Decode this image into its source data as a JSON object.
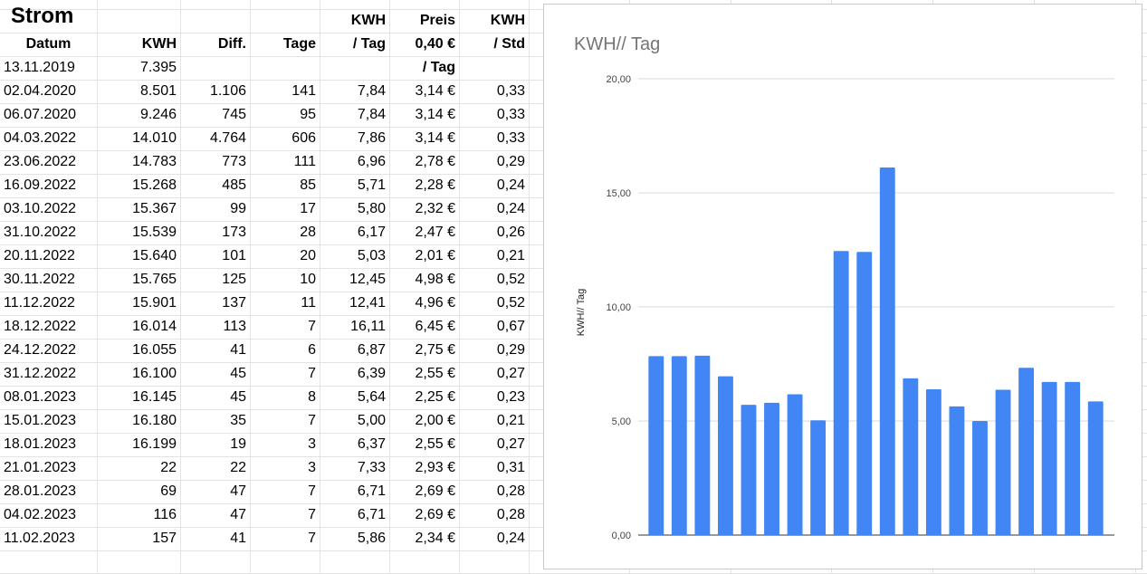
{
  "sheet": {
    "title": "Strom",
    "header_top": [
      "",
      "",
      "",
      "KWH",
      "Preis",
      "KWH"
    ],
    "header": [
      "Datum",
      "KWH",
      "Diff.",
      "Tage",
      "/ Tag",
      "0,40 €",
      "/ Std"
    ],
    "subheader_price": "/ Tag",
    "rows": [
      [
        "13.11.2019",
        "7.395",
        "",
        "",
        "",
        "",
        ""
      ],
      [
        "02.04.2020",
        "8.501",
        "1.106",
        "141",
        "7,84",
        "3,14 €",
        "0,33"
      ],
      [
        "06.07.2020",
        "9.246",
        "745",
        "95",
        "7,84",
        "3,14 €",
        "0,33"
      ],
      [
        "04.03.2022",
        "14.010",
        "4.764",
        "606",
        "7,86",
        "3,14 €",
        "0,33"
      ],
      [
        "23.06.2022",
        "14.783",
        "773",
        "111",
        "6,96",
        "2,78 €",
        "0,29"
      ],
      [
        "16.09.2022",
        "15.268",
        "485",
        "85",
        "5,71",
        "2,28 €",
        "0,24"
      ],
      [
        "03.10.2022",
        "15.367",
        "99",
        "17",
        "5,80",
        "2,32 €",
        "0,24"
      ],
      [
        "31.10.2022",
        "15.539",
        "173",
        "28",
        "6,17",
        "2,47 €",
        "0,26"
      ],
      [
        "20.11.2022",
        "15.640",
        "101",
        "20",
        "5,03",
        "2,01 €",
        "0,21"
      ],
      [
        "30.11.2022",
        "15.765",
        "125",
        "10",
        "12,45",
        "4,98 €",
        "0,52"
      ],
      [
        "11.12.2022",
        "15.901",
        "137",
        "11",
        "12,41",
        "4,96 €",
        "0,52"
      ],
      [
        "18.12.2022",
        "16.014",
        "113",
        "7",
        "16,11",
        "6,45 €",
        "0,67"
      ],
      [
        "24.12.2022",
        "16.055",
        "41",
        "6",
        "6,87",
        "2,75 €",
        "0,29"
      ],
      [
        "31.12.2022",
        "16.100",
        "45",
        "7",
        "6,39",
        "2,55 €",
        "0,27"
      ],
      [
        "08.01.2023",
        "16.145",
        "45",
        "8",
        "5,64",
        "2,25 €",
        "0,23"
      ],
      [
        "15.01.2023",
        "16.180",
        "35",
        "7",
        "5,00",
        "2,00 €",
        "0,21"
      ],
      [
        "18.01.2023",
        "16.199",
        "19",
        "3",
        "6,37",
        "2,55 €",
        "0,27"
      ],
      [
        "21.01.2023",
        "22",
        "22",
        "3",
        "7,33",
        "2,93 €",
        "0,31"
      ],
      [
        "28.01.2023",
        "69",
        "47",
        "7",
        "6,71",
        "2,69 €",
        "0,28"
      ],
      [
        "04.02.2023",
        "116",
        "47",
        "7",
        "6,71",
        "2,69 €",
        "0,28"
      ],
      [
        "11.02.2023",
        "157",
        "41",
        "7",
        "5,86",
        "2,34 €",
        "0,24"
      ]
    ]
  },
  "chart_data": {
    "type": "bar",
    "title": "KWH// Tag",
    "ylabel": "KWH// Tag",
    "xlabel": "",
    "ylim": [
      0,
      20
    ],
    "yticks": [
      "0,00",
      "5,00",
      "10,00",
      "15,00",
      "20,00"
    ],
    "bar_color": "#4285f4",
    "grid": true,
    "values": [
      7.84,
      7.84,
      7.86,
      6.96,
      5.71,
      5.8,
      6.17,
      5.03,
      12.45,
      12.41,
      16.11,
      6.87,
      6.39,
      5.64,
      5.0,
      6.37,
      7.33,
      6.71,
      6.71,
      5.86
    ]
  }
}
